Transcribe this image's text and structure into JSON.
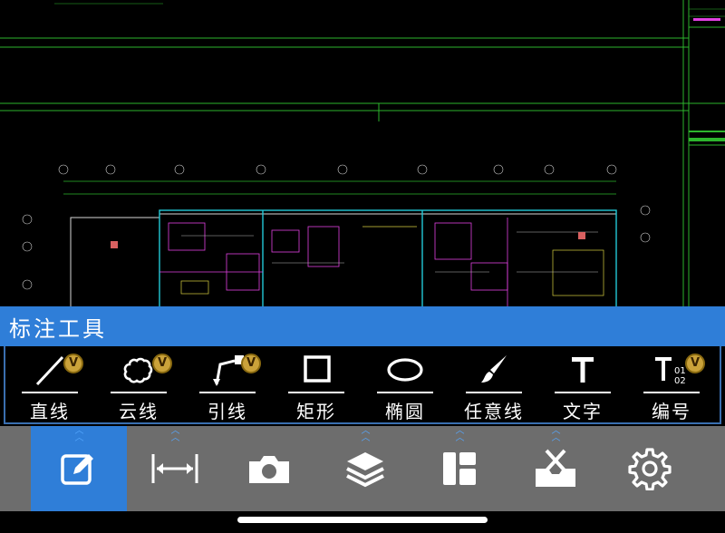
{
  "panel": {
    "title": "标注工具"
  },
  "tools": [
    {
      "id": "line",
      "label": "直线",
      "icon": "line-icon",
      "badge": "V"
    },
    {
      "id": "cloud",
      "label": "云线",
      "icon": "cloud-line-icon",
      "badge": "V"
    },
    {
      "id": "leader",
      "label": "引线",
      "icon": "leader-line-icon",
      "badge": "V"
    },
    {
      "id": "rect",
      "label": "矩形",
      "icon": "rectangle-icon",
      "badge": ""
    },
    {
      "id": "ellipse",
      "label": "椭圆",
      "icon": "ellipse-icon",
      "badge": ""
    },
    {
      "id": "freehand",
      "label": "任意线",
      "icon": "brush-icon",
      "badge": ""
    },
    {
      "id": "text",
      "label": "文字",
      "icon": "text-icon",
      "badge": ""
    },
    {
      "id": "number",
      "label": "编号",
      "icon": "numbering-icon",
      "badge": "V",
      "sub": [
        "01",
        "02"
      ]
    }
  ],
  "nav": [
    {
      "id": "annotate",
      "icon": "edit-icon",
      "active": true
    },
    {
      "id": "measure",
      "icon": "measure-icon",
      "active": false
    },
    {
      "id": "camera",
      "icon": "camera-icon",
      "active": false
    },
    {
      "id": "layers",
      "icon": "layers-icon",
      "active": false
    },
    {
      "id": "layout",
      "icon": "layout-icon",
      "active": false
    },
    {
      "id": "toolbox",
      "icon": "toolbox-icon",
      "active": false
    },
    {
      "id": "settings",
      "icon": "gear-icon",
      "active": false
    }
  ],
  "colors": {
    "accent": "#2f7ed8",
    "navBg": "#6d6d6d",
    "badge": "#caa23a",
    "cadGreen": "#2db52d",
    "cadCyan": "#22c9d6",
    "cadMagenta": "#e040e0",
    "cadYellow": "#d8d040"
  }
}
